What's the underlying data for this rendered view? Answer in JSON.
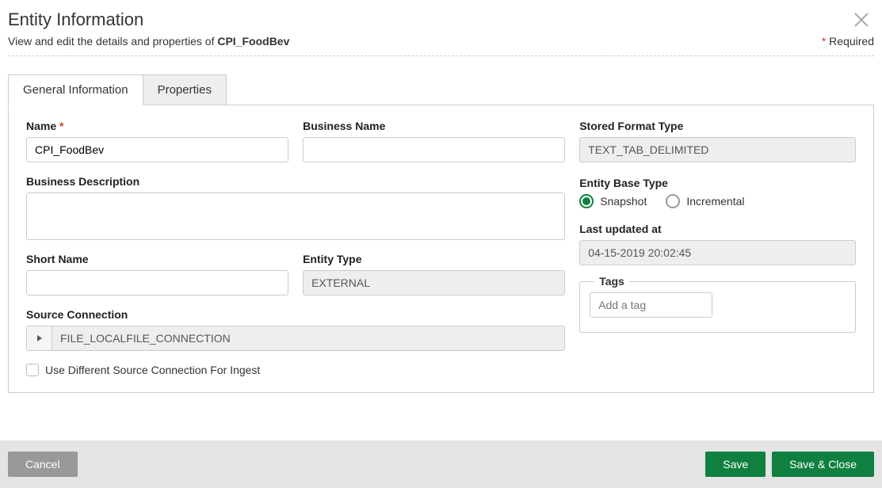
{
  "header": {
    "title": "Entity Information",
    "subtitle_prefix": "View and edit the details and properties of ",
    "subtitle_entity": "CPI_FoodBev",
    "required_label": "Required"
  },
  "tabs": {
    "general": "General Information",
    "properties": "Properties"
  },
  "fields": {
    "name_label": "Name",
    "name_value": "CPI_FoodBev",
    "business_name_label": "Business Name",
    "business_name_value": "",
    "business_desc_label": "Business Description",
    "business_desc_value": "",
    "short_name_label": "Short Name",
    "short_name_value": "",
    "entity_type_label": "Entity Type",
    "entity_type_value": "EXTERNAL",
    "source_conn_label": "Source Connection",
    "source_conn_value": "FILE_LOCALFILE_CONNECTION",
    "diff_source_label": "Use Different Source Connection For Ingest",
    "stored_format_label": "Stored Format Type",
    "stored_format_value": "TEXT_TAB_DELIMITED",
    "base_type_label": "Entity Base Type",
    "base_type_snapshot": "Snapshot",
    "base_type_incremental": "Incremental",
    "last_updated_label": "Last updated at",
    "last_updated_value": "04-15-2019 20:02:45",
    "tags_label": "Tags",
    "tags_placeholder": "Add a tag"
  },
  "footer": {
    "cancel": "Cancel",
    "save": "Save",
    "save_close": "Save & Close"
  }
}
